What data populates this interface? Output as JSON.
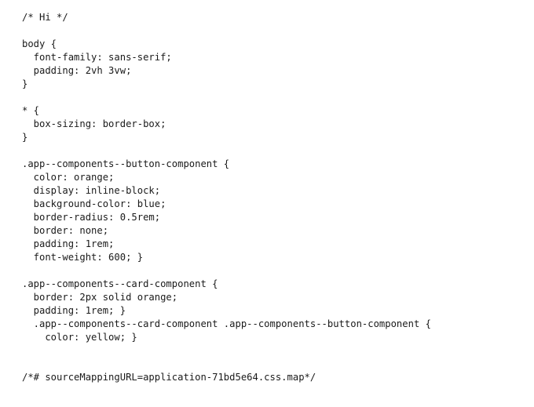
{
  "code": {
    "lines": [
      "/* Hi */",
      "",
      "body {",
      "  font-family: sans-serif;",
      "  padding: 2vh 3vw;",
      "}",
      "",
      "* {",
      "  box-sizing: border-box;",
      "}",
      "",
      ".app--components--button-component {",
      "  color: orange;",
      "  display: inline-block;",
      "  background-color: blue;",
      "  border-radius: 0.5rem;",
      "  border: none;",
      "  padding: 1rem;",
      "  font-weight: 600; }",
      "",
      ".app--components--card-component {",
      "  border: 2px solid orange;",
      "  padding: 1rem; }",
      "  .app--components--card-component .app--components--button-component {",
      "    color: yellow; }",
      "",
      "",
      "/*# sourceMappingURL=application-71bd5e64.css.map*/"
    ]
  }
}
